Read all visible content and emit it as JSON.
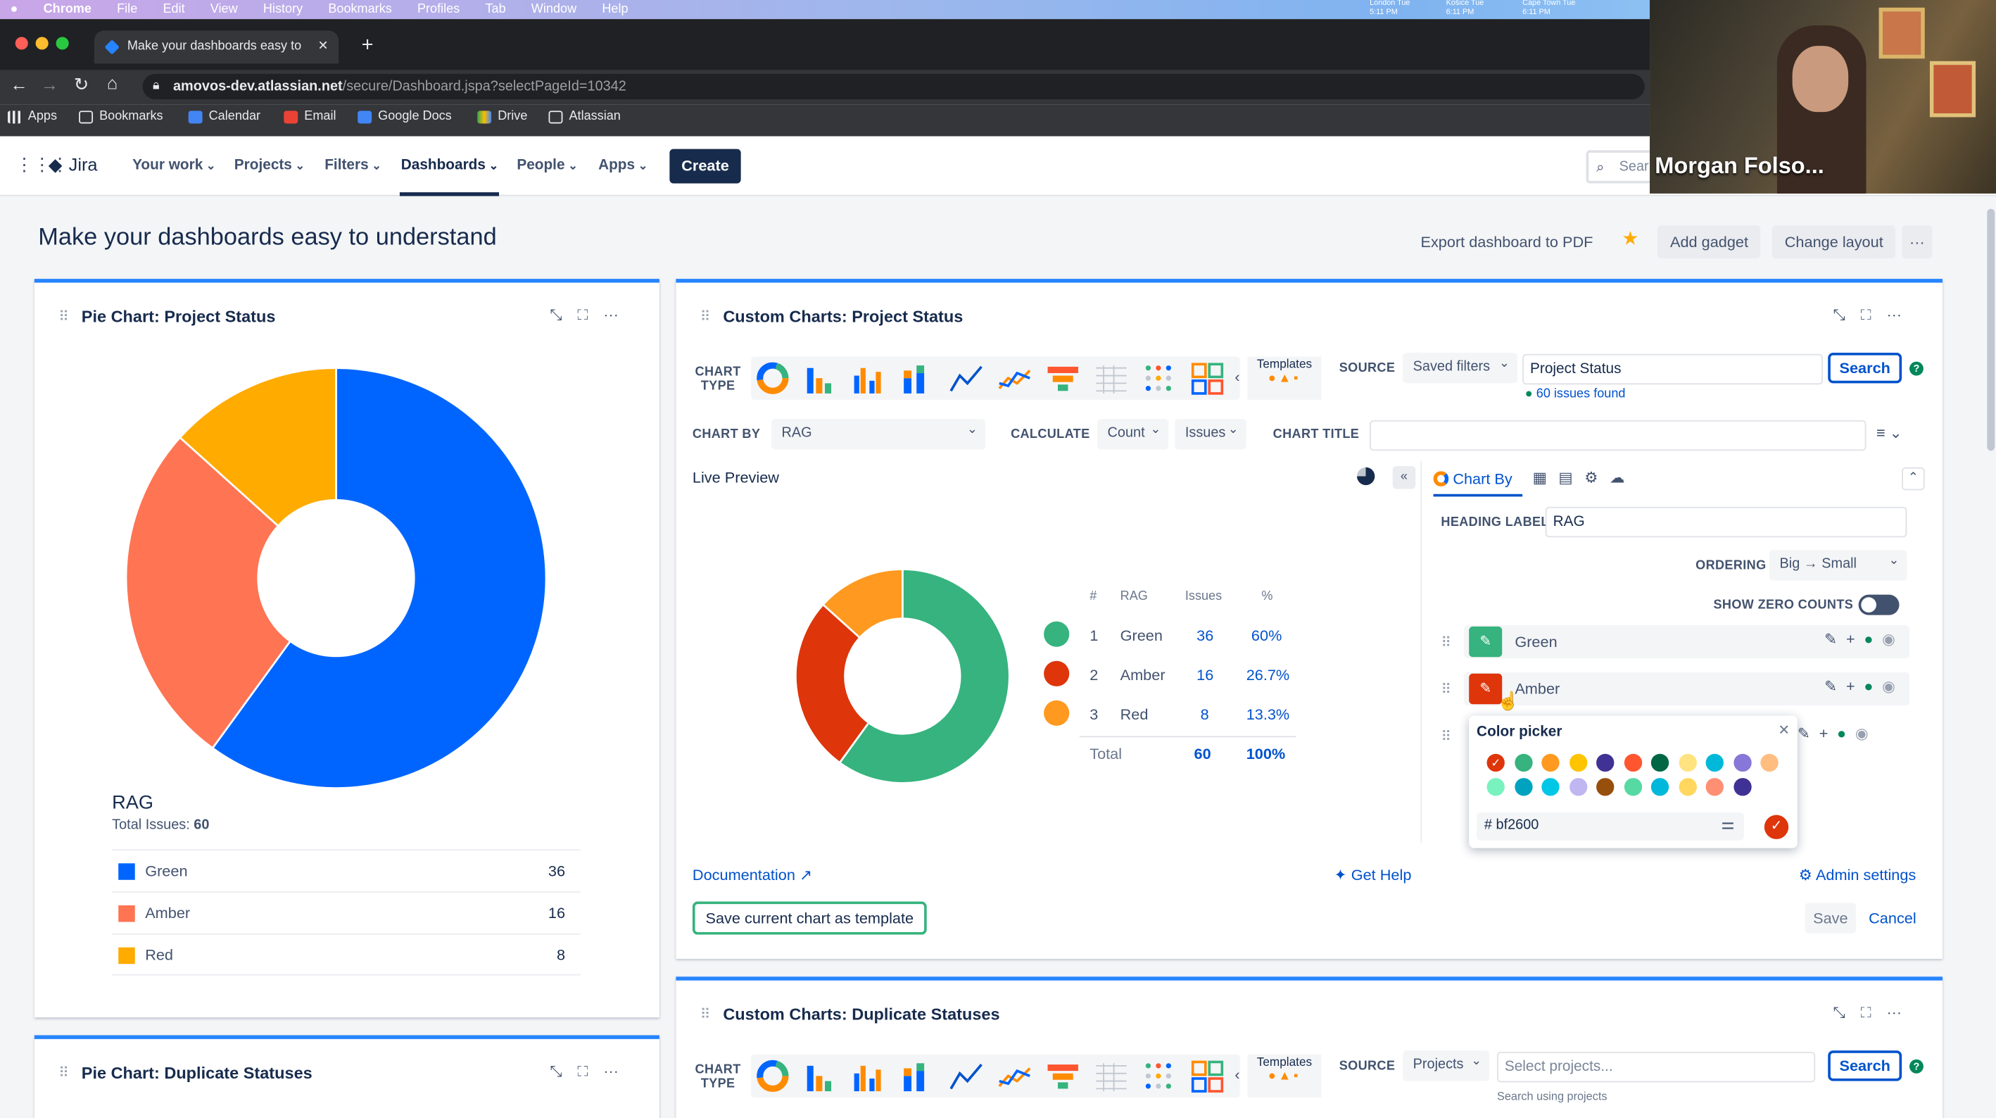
{
  "mac_menu": {
    "apple": "",
    "items": [
      "Chrome",
      "File",
      "Edit",
      "View",
      "History",
      "Bookmarks",
      "Profiles",
      "Tab",
      "Window",
      "Help"
    ],
    "clocks": [
      "London Tue 5:11 PM",
      "Košice Tue 6:11 PM",
      "Cape Town Tue 6:11 PM"
    ]
  },
  "browser": {
    "tab_title": "Make your dashboards easy to",
    "url_host": "amovos-dev.atlassian.net",
    "url_path": "/secure/Dashboard.jspa?selectPageId=10342",
    "bookmarks": [
      "Apps",
      "Bookmarks",
      "Calendar",
      "Email",
      "Google Docs",
      "Drive",
      "Atlassian"
    ]
  },
  "jira": {
    "logo": "Jira",
    "nav": [
      "Your work",
      "Projects",
      "Filters",
      "Dashboards",
      "People",
      "Apps"
    ],
    "create": "Create",
    "search_placeholder": "Sear"
  },
  "video": {
    "name": "Morgan Folso..."
  },
  "dashboard": {
    "title": "Make your dashboards easy to understand",
    "actions": {
      "export": "Export dashboard to PDF",
      "add_gadget": "Add gadget",
      "change_layout": "Change layout",
      "more": "···"
    }
  },
  "pie_gadget": {
    "title": "Pie Chart: Project Status",
    "legend_title": "RAG",
    "total_label": "Total Issues:",
    "total_value": "60",
    "items": [
      {
        "name": "Green",
        "value": "36",
        "color": "#0065ff"
      },
      {
        "name": "Amber",
        "value": "16",
        "color": "#ff7452"
      },
      {
        "name": "Red",
        "value": "8",
        "color": "#ffab00"
      }
    ]
  },
  "pie_gadget2": {
    "title": "Pie Chart: Duplicate Statuses"
  },
  "custom_gadget": {
    "title": "Custom Charts: Project Status",
    "chart_type_label": "CHART TYPE",
    "templates": "Templates",
    "source_label": "SOURCE",
    "source_select": "Saved filters",
    "source_value": "Project Status",
    "search": "Search",
    "found": "60 issues found",
    "chart_by_label": "CHART BY",
    "chart_by_value": "RAG",
    "calculate_label": "CALCULATE",
    "calc_count": "Count",
    "calc_issues": "Issues",
    "chart_title_label": "CHART TITLE",
    "live_preview": "Live Preview",
    "table_headers": [
      "#",
      "RAG",
      "Issues",
      "%"
    ],
    "rows": [
      {
        "n": "1",
        "name": "Green",
        "issues": "36",
        "pct": "60%",
        "color": "#36b37e"
      },
      {
        "n": "2",
        "name": "Amber",
        "issues": "16",
        "pct": "26.7%",
        "color": "#de350b"
      },
      {
        "n": "3",
        "name": "Red",
        "issues": "8",
        "pct": "13.3%",
        "color": "#ff991f"
      }
    ],
    "total_label": "Total",
    "total_issues": "60",
    "total_pct": "100%",
    "panel_tab": "Chart By",
    "heading_label": "HEADING LABEL",
    "heading_value": "RAG",
    "ordering_label": "ORDERING",
    "ordering_value": "Big → Small",
    "zero_counts_label": "SHOW ZERO COUNTS",
    "categories": [
      {
        "name": "Green",
        "color": "#36b37e"
      },
      {
        "name": "Amber",
        "color": "#de350b"
      }
    ],
    "picker_title": "Color picker",
    "picker_hex": "# bf2600",
    "documentation": "Documentation",
    "get_help": "Get Help",
    "admin_settings": "Admin settings",
    "save_template": "Save current chart as template",
    "save": "Save",
    "cancel": "Cancel"
  },
  "custom_gadget2": {
    "title": "Custom Charts: Duplicate Statuses",
    "chart_type_label": "CHART TYPE",
    "templates": "Templates",
    "source_label": "SOURCE",
    "source_select": "Projects",
    "source_placeholder": "Select projects...",
    "search": "Search",
    "hint": "Search using projects"
  },
  "palette": [
    "#de350b",
    "#36b37e",
    "#ff991f",
    "#ffc400",
    "#403294",
    "#ff5630",
    "#006644",
    "#ffe380",
    "#00b8d9",
    "#8777d9",
    "#ffbd80",
    "#79f2c0",
    "#00a3bf",
    "#00c7e6",
    "#c0b6f2",
    "#974f0c",
    "#57d9a3",
    "#00b8d9",
    "#ffd75e",
    "#ff8f73",
    "#403294"
  ],
  "chart_data": [
    {
      "type": "pie",
      "title": "Pie Chart: Project Status",
      "categories": [
        "Green",
        "Amber",
        "Red"
      ],
      "values": [
        36,
        16,
        8
      ],
      "colors": [
        "#0065ff",
        "#ff7452",
        "#ffab00"
      ],
      "legend": "bottom"
    },
    {
      "type": "pie",
      "title": "",
      "categories": [
        "Green",
        "Amber",
        "Red"
      ],
      "values": [
        36,
        16,
        8
      ],
      "colors": [
        "#36b37e",
        "#de350b",
        "#ff991f"
      ],
      "legend": "right"
    }
  ]
}
